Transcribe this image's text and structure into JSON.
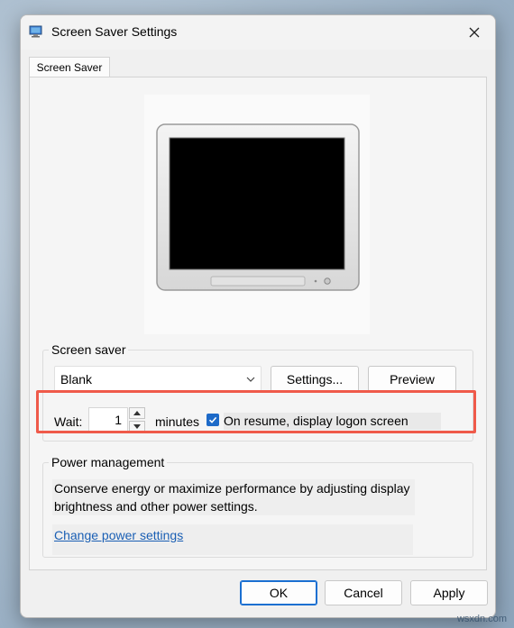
{
  "window": {
    "title": "Screen Saver Settings",
    "icon": "screen-saver-app-icon",
    "close_icon": "close-icon"
  },
  "tabs": [
    {
      "label": "Screen Saver",
      "selected": true
    }
  ],
  "screen_saver": {
    "group_label": "Screen saver",
    "selected": "Blank",
    "settings_button": "Settings...",
    "preview_button": "Preview",
    "wait_label": "Wait:",
    "wait_value": "1",
    "minutes_label": "minutes",
    "resume_checkbox_label": "On resume, display logon screen",
    "resume_checked": true
  },
  "power_management": {
    "group_label": "Power management",
    "description": "Conserve energy or maximize performance by adjusting display brightness and other power settings.",
    "link": "Change power settings"
  },
  "buttons": {
    "ok": "OK",
    "cancel": "Cancel",
    "apply": "Apply"
  },
  "watermark": "wsxdn.com",
  "colors": {
    "accent": "#1d6ac8",
    "link": "#1a5fb4",
    "highlight": "#ef5a4a"
  }
}
